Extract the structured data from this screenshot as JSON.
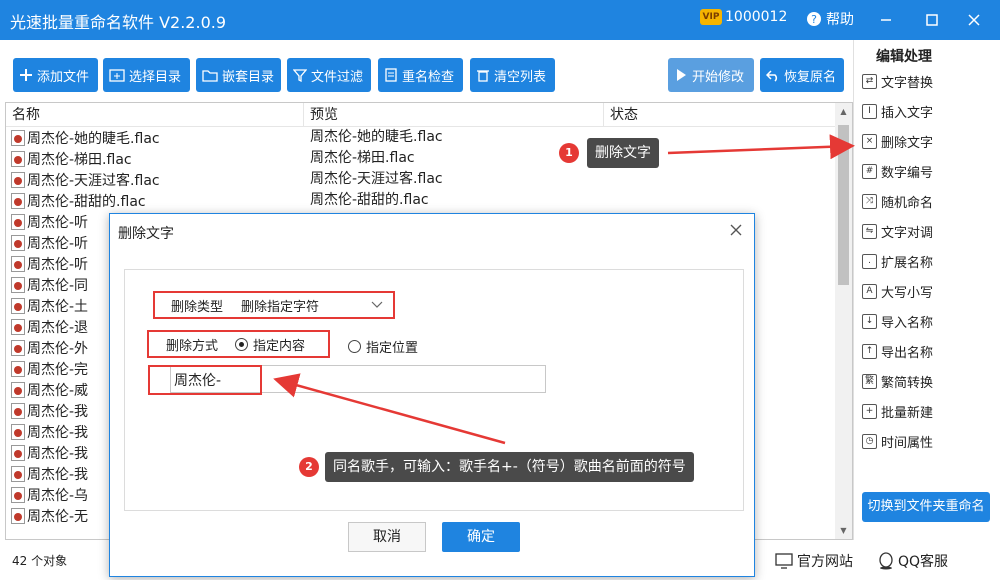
{
  "app": {
    "title": "光速批量重命名软件 V2.2.0.9",
    "vip_id": "1000012",
    "help": "帮助"
  },
  "toolbar": {
    "add_file": "添加文件",
    "select_dir": "选择目录",
    "nested_dir": "嵌套目录",
    "file_filter": "文件过滤",
    "dup_check": "重名检查",
    "clear_list": "清空列表",
    "start": "开始修改",
    "restore": "恢复原名"
  },
  "list": {
    "columns": [
      "名称",
      "预览",
      "状态"
    ],
    "rows": [
      {
        "name": "周杰伦-她的睫毛.flac",
        "preview": "周杰伦-她的睫毛.flac"
      },
      {
        "name": "周杰伦-梯田.flac",
        "preview": "周杰伦-梯田.flac"
      },
      {
        "name": "周杰伦-天涯过客.flac",
        "preview": "周杰伦-天涯过客.flac"
      },
      {
        "name": "周杰伦-甜甜的.flac",
        "preview": "周杰伦-甜甜的.flac"
      },
      {
        "name": "周杰伦-听",
        "preview": ""
      },
      {
        "name": "周杰伦-听",
        "preview": ""
      },
      {
        "name": "周杰伦-听",
        "preview": ""
      },
      {
        "name": "周杰伦-同",
        "preview": ""
      },
      {
        "name": "周杰伦-土",
        "preview": ""
      },
      {
        "name": "周杰伦-退",
        "preview": ""
      },
      {
        "name": "周杰伦-外",
        "preview": ""
      },
      {
        "name": "周杰伦-完",
        "preview": ""
      },
      {
        "name": "周杰伦-威",
        "preview": ""
      },
      {
        "name": "周杰伦-我",
        "preview": ""
      },
      {
        "name": "周杰伦-我",
        "preview": ""
      },
      {
        "name": "周杰伦-我",
        "preview": ""
      },
      {
        "name": "周杰伦-我",
        "preview": ""
      },
      {
        "name": "周杰伦-乌",
        "preview": ""
      },
      {
        "name": "周杰伦-无",
        "preview": ""
      }
    ]
  },
  "status": {
    "count": "42 个对象",
    "official": "官方网站",
    "qq": "QQ客服"
  },
  "sidebar": {
    "heading": "编辑处理",
    "items": [
      "文字替换",
      "插入文字",
      "删除文字",
      "数字编号",
      "随机命名",
      "文字对调",
      "扩展名称",
      "大写小写",
      "导入名称",
      "导出名称",
      "繁简转换",
      "批量新建",
      "时间属性"
    ],
    "switch": "切换到文件夹重命名"
  },
  "dialog": {
    "title": "删除文字",
    "type_label": "删除类型",
    "type_value": "删除指定字符",
    "method_label": "删除方式",
    "opt_content": "指定内容",
    "opt_position": "指定位置",
    "input_value": "周杰伦-",
    "cancel": "取消",
    "ok": "确定"
  },
  "annotations": {
    "callout1_num": "1",
    "callout1_text": "删除文字",
    "callout2_num": "2",
    "callout2_text": "同名歌手，可输入：歌手名+-（符号）歌曲名前面的符号"
  },
  "colors": {
    "accent": "#1f84e0",
    "highlight": "#e53935",
    "callout_bg": "#4a4a4a"
  }
}
